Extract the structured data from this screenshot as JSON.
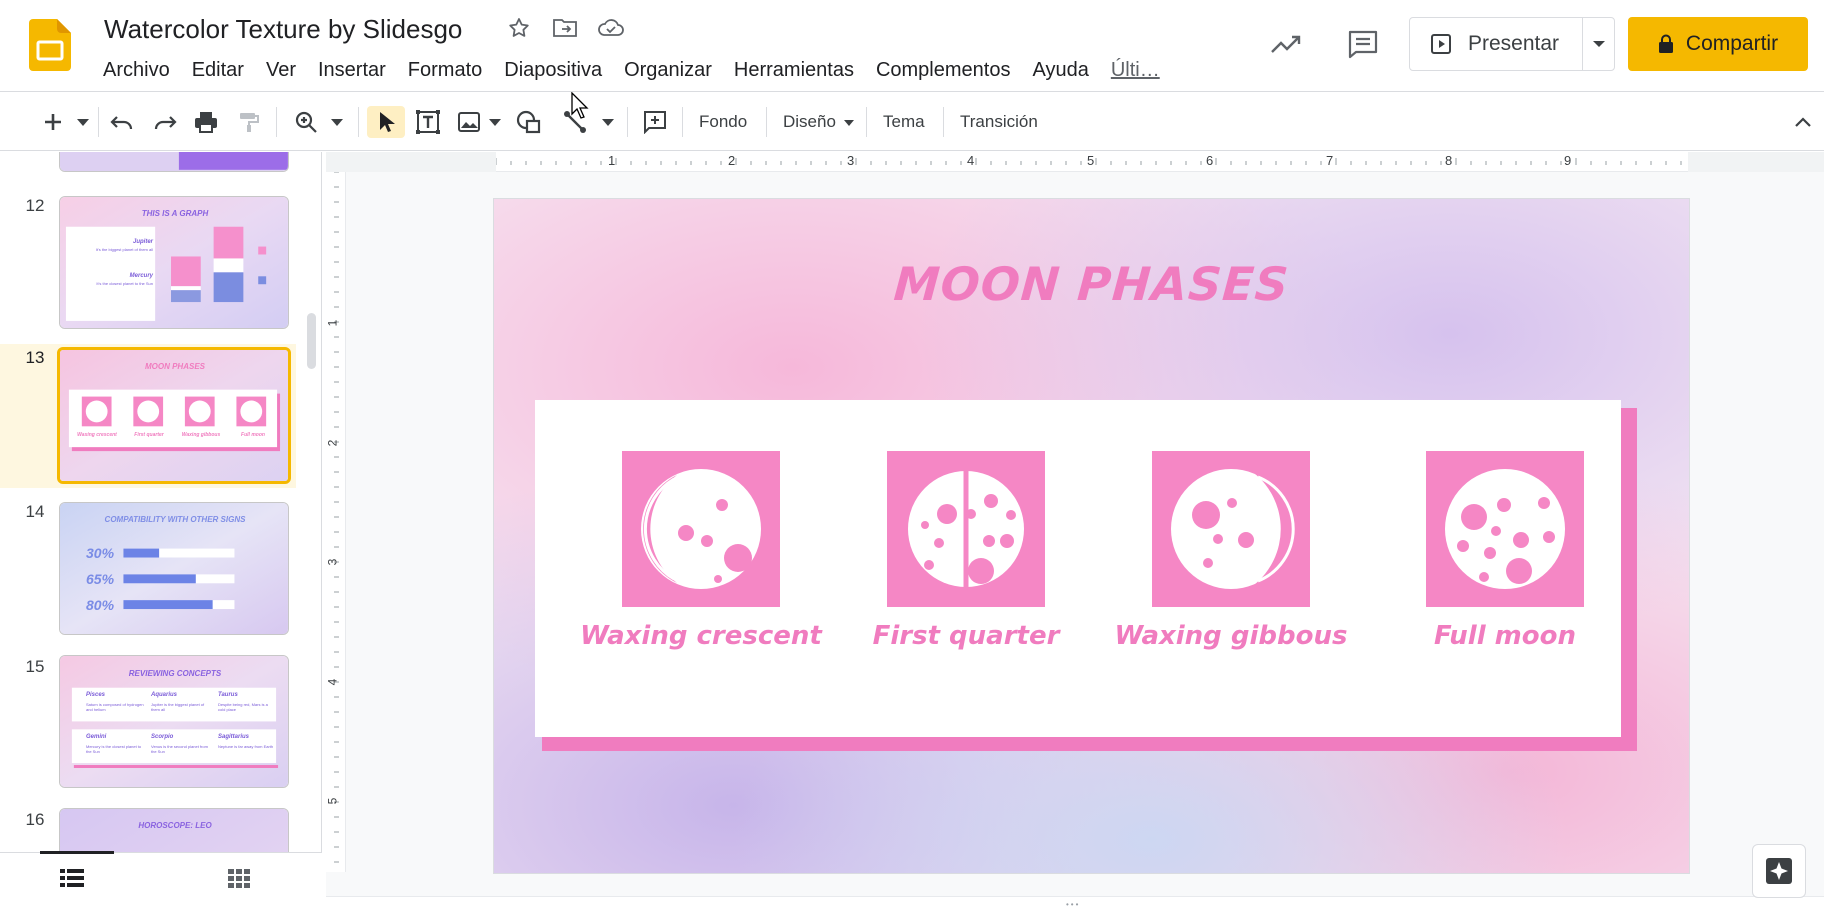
{
  "app": {
    "doc_title": "Watercolor Texture by Slidesgo",
    "menu": [
      "Archivo",
      "Editar",
      "Ver",
      "Insertar",
      "Formato",
      "Diapositiva",
      "Organizar",
      "Herramientas",
      "Complementos",
      "Ayuda"
    ],
    "last_edit": "Últi…",
    "present_label": "Presentar",
    "share_label": "Compartir",
    "brand_color": "#f5b800"
  },
  "toolbar": {
    "fondo": "Fondo",
    "diseno": "Diseño",
    "tema": "Tema",
    "transicion": "Transición"
  },
  "rulers": {
    "h": [
      "1",
      "2",
      "3",
      "4",
      "5",
      "6",
      "7",
      "8",
      "9"
    ],
    "v": [
      "1",
      "2",
      "3",
      "4",
      "5"
    ]
  },
  "filmstrip": {
    "slides": [
      {
        "num": "12",
        "title": "THIS IS A GRAPH",
        "lines": [
          "Jupiter",
          "It's the biggest planet of them all",
          "Mercury",
          "It's the closest planet to the Sun"
        ]
      },
      {
        "num": "13",
        "title": "MOON PHASES",
        "lines": [
          "Waxing crescent",
          "First quarter",
          "Waxing gibbous",
          "Full moon"
        ]
      },
      {
        "num": "14",
        "title": "COMPATIBILITY WITH OTHER SIGNS",
        "bars": [
          "30%",
          "65%",
          "80%"
        ]
      },
      {
        "num": "15",
        "title": "REVIEWING CONCEPTS",
        "items": [
          [
            "Pisces",
            "Saturn is composed of hydrogen and helium"
          ],
          [
            "Aquarius",
            "Jupiter is the biggest planet of them all"
          ],
          [
            "Taurus",
            "Despite being red, Mars is a cold place"
          ],
          [
            "Gemini",
            "Mercury is the closest planet to the Sun"
          ],
          [
            "Scorpio",
            "Venus is the second planet from the Sun"
          ],
          [
            "Sagittarius",
            "Neptune is far away from Earth"
          ]
        ]
      },
      {
        "num": "16",
        "title": "HOROSCOPE: LEO"
      }
    ]
  },
  "slide": {
    "title": "MOON PHASES",
    "phases": [
      {
        "label": "Waxing crescent",
        "icon": "waxing-crescent-icon"
      },
      {
        "label": "First quarter",
        "icon": "first-quarter-icon"
      },
      {
        "label": "Waxing gibbous",
        "icon": "waxing-gibbous-icon"
      },
      {
        "label": "Full moon",
        "icon": "full-moon-icon"
      }
    ],
    "accent": "#f07cbf"
  }
}
